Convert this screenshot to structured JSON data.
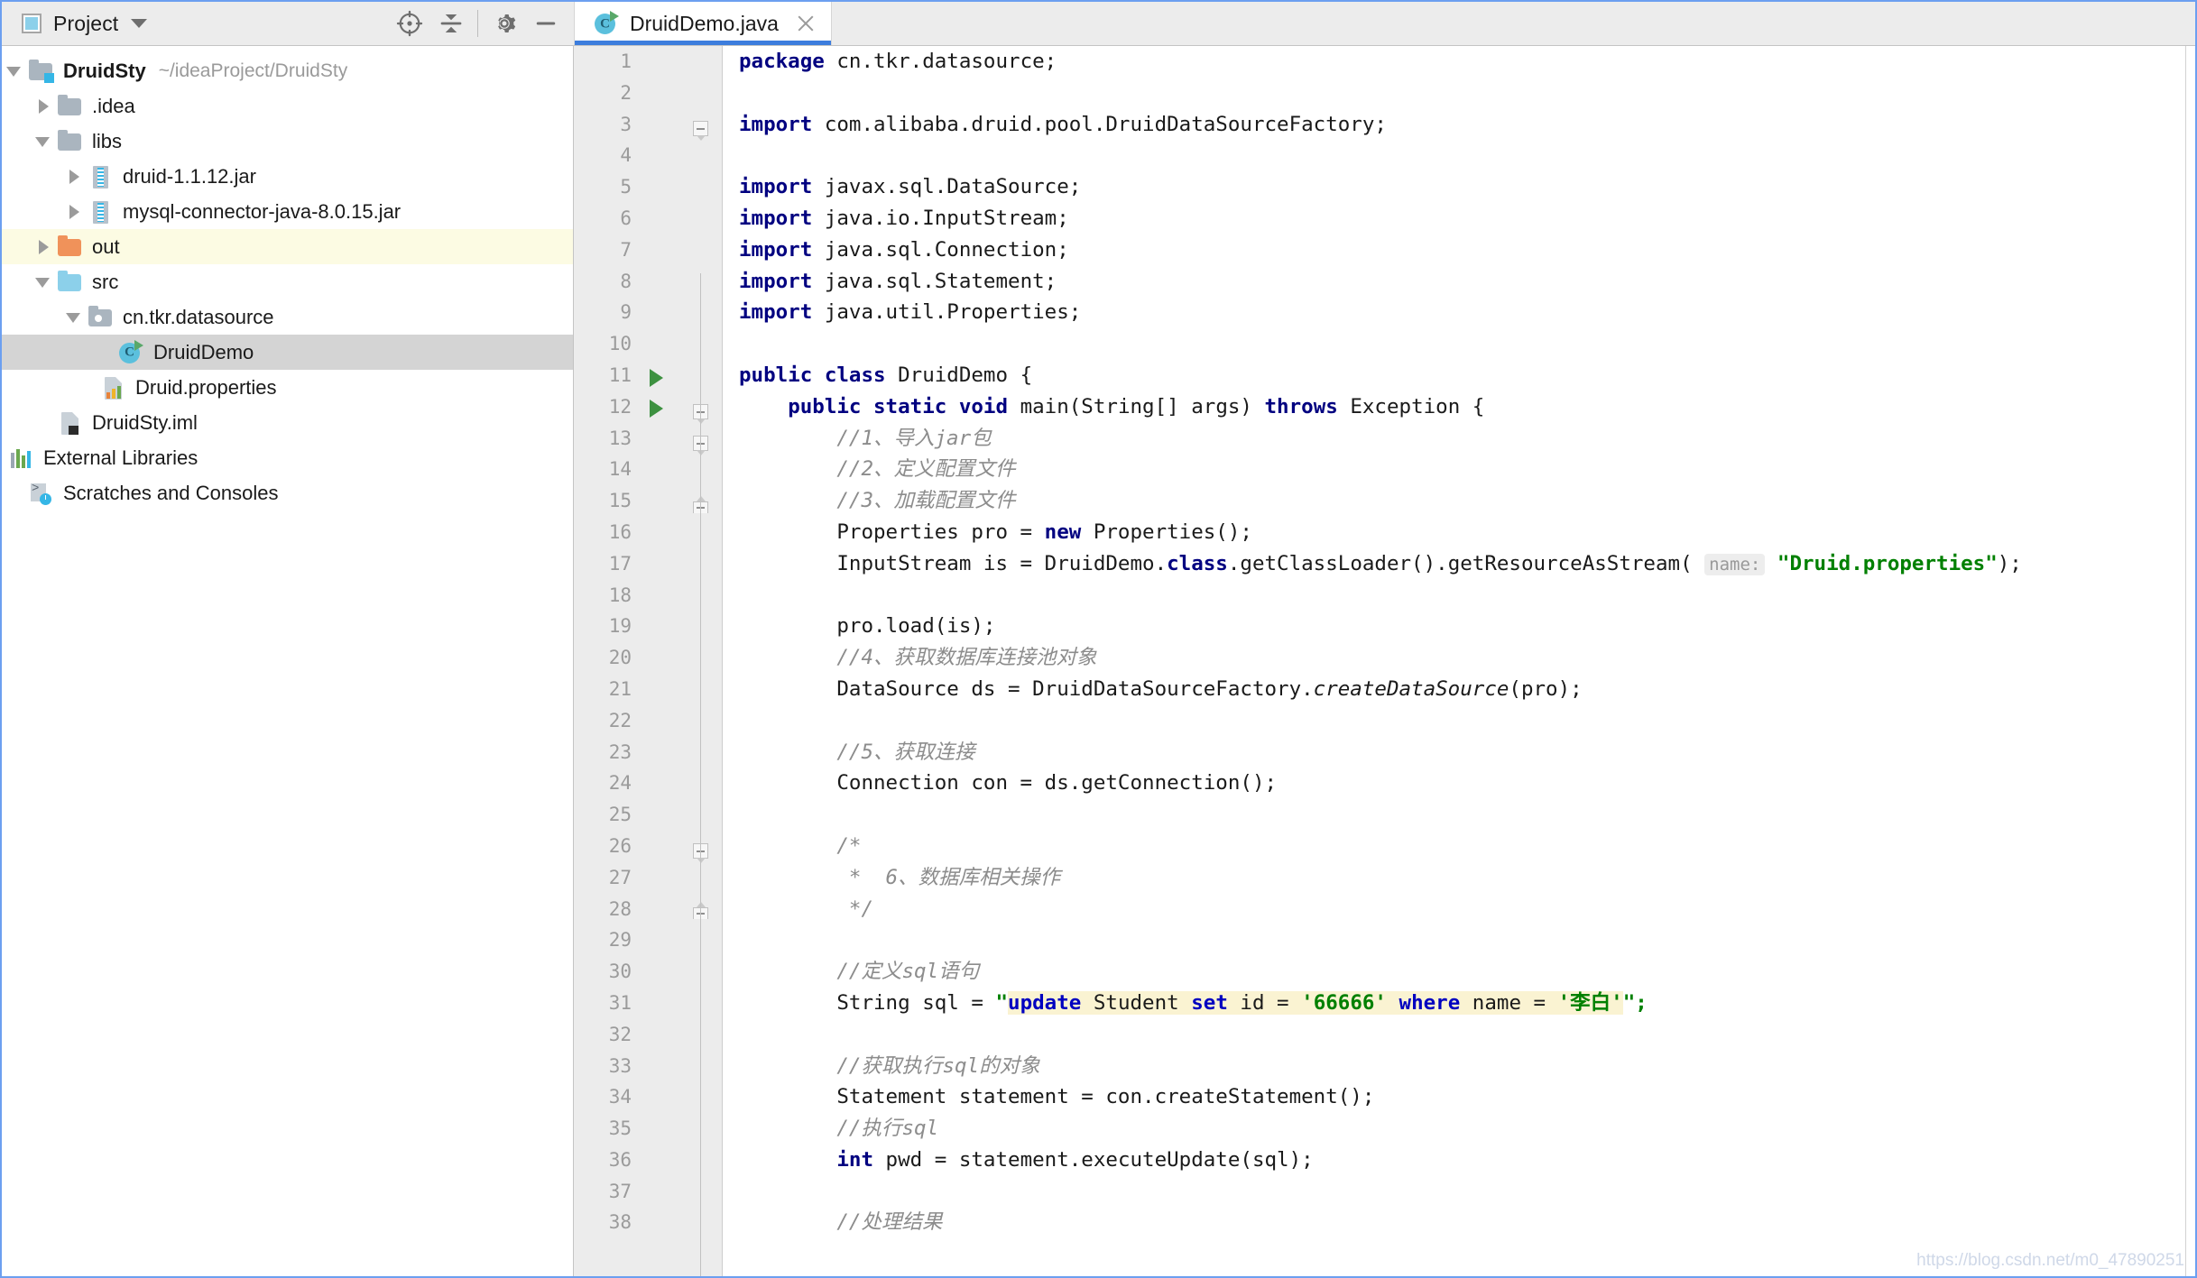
{
  "window": {
    "accent_color": "#3c7ddd",
    "border_color": "#6c9ff0"
  },
  "tool_window": {
    "title": "Project",
    "dropdown_icon": "chevron-down-icon",
    "actions": [
      {
        "name": "locate-in-tree",
        "icon": "crosshair-target-icon"
      },
      {
        "name": "collapse-all",
        "icon": "collapse-all-icon"
      },
      {
        "name": "settings",
        "icon": "gear-icon"
      },
      {
        "name": "hide-tool-window",
        "icon": "minimize-icon"
      }
    ]
  },
  "editor_tabs": [
    {
      "label": "DruidDemo.java",
      "icon": "java-class-runnable-icon",
      "active": true,
      "close_icon": "close-icon"
    }
  ],
  "project_tree": [
    {
      "label": "DruidSty",
      "path": "~/ideaProject/DruidSty",
      "indent": 0,
      "twisty": "open",
      "icon": "module-folder-icon",
      "bold": true,
      "state": "normal"
    },
    {
      "label": ".idea",
      "indent": 1,
      "twisty": "closed",
      "icon": "folder-icon",
      "bold": false,
      "state": "normal"
    },
    {
      "label": "libs",
      "indent": 1,
      "twisty": "open",
      "icon": "folder-icon",
      "bold": false,
      "state": "normal"
    },
    {
      "label": "druid-1.1.12.jar",
      "indent": 2,
      "twisty": "closed",
      "icon": "jar-icon",
      "bold": false,
      "state": "normal"
    },
    {
      "label": "mysql-connector-java-8.0.15.jar",
      "indent": 2,
      "twisty": "closed",
      "icon": "jar-icon",
      "bold": false,
      "state": "normal"
    },
    {
      "label": "out",
      "indent": 1,
      "twisty": "closed",
      "icon": "excluded-folder-icon",
      "bold": false,
      "state": "excluded"
    },
    {
      "label": "src",
      "indent": 1,
      "twisty": "open",
      "icon": "source-folder-icon",
      "bold": false,
      "state": "normal"
    },
    {
      "label": "cn.tkr.datasource",
      "indent": 2,
      "twisty": "open",
      "icon": "package-icon",
      "bold": false,
      "state": "normal"
    },
    {
      "label": "DruidDemo",
      "indent": 3,
      "twisty": "none",
      "icon": "java-class-runnable-icon",
      "bold": false,
      "state": "selected"
    },
    {
      "label": "Druid.properties",
      "indent": 3,
      "twisty": "none",
      "icon": "properties-file-icon",
      "bold": false,
      "state": "normal"
    },
    {
      "label": "DruidSty.iml",
      "indent": 1,
      "twisty": "none",
      "icon": "iml-file-icon",
      "bold": false,
      "state": "normal"
    },
    {
      "label": "External Libraries",
      "indent": 0,
      "twisty": "closed",
      "icon": "external-libraries-icon",
      "bold": false,
      "state": "normal"
    },
    {
      "label": "Scratches and Consoles",
      "indent": 0,
      "twisty": "none",
      "icon": "scratches-icon",
      "bold": false,
      "state": "normal"
    }
  ],
  "editor": {
    "file_name": "DruidDemo.java",
    "first_visible_line": 1,
    "last_visible_line": 38,
    "run_gutter_lines": [
      11,
      12
    ],
    "fold_marks": [
      {
        "line": 3,
        "type": "start"
      },
      {
        "line": 12,
        "type": "start"
      },
      {
        "line": 13,
        "type": "start"
      },
      {
        "line": 15,
        "type": "end"
      },
      {
        "line": 26,
        "type": "start"
      },
      {
        "line": 28,
        "type": "end"
      }
    ],
    "line_numbers": [
      1,
      2,
      3,
      4,
      5,
      6,
      7,
      8,
      9,
      10,
      11,
      12,
      13,
      14,
      15,
      16,
      17,
      18,
      19,
      20,
      21,
      22,
      23,
      24,
      25,
      26,
      27,
      28,
      29,
      30,
      31,
      32,
      33,
      34,
      35,
      36,
      37,
      38
    ],
    "code_lines": [
      "package cn.tkr.datasource;",
      "",
      "import com.alibaba.druid.pool.DruidDataSourceFactory;",
      "",
      "import javax.sql.DataSource;",
      "import java.io.InputStream;",
      "import java.sql.Connection;",
      "import java.sql.Statement;",
      "import java.util.Properties;",
      "",
      "public class DruidDemo {",
      "    public static void main(String[] args) throws Exception {",
      "        //1、导入jar包",
      "        //2、定义配置文件",
      "        //3、加载配置文件",
      "        Properties pro = new Properties();",
      "        InputStream is = DruidDemo.class.getClassLoader().getResourceAsStream( name: \"Druid.properties\");",
      "",
      "        pro.load(is);",
      "        //4、获取数据库连接池对象",
      "        DataSource ds = DruidDataSourceFactory.createDataSource(pro);",
      "",
      "        //5、获取连接",
      "        Connection con = ds.getConnection();",
      "",
      "        /*",
      "         *  6、数据库相关操作",
      "         */",
      "",
      "        //定义sql语句",
      "        String sql = \"update Student set id = '66666' where name = '李白'\";",
      "",
      "        //获取执行sql的对象",
      "        Statement statement = con.createStatement();",
      "        //执行sql",
      "        int pwd = statement.executeUpdate(sql);",
      "",
      "        //处理结果"
    ],
    "parameter_hint": "name:",
    "string_literal": "\"Druid.properties\"",
    "sql_string": {
      "open_quote": "\"",
      "tokens": [
        {
          "text": "update",
          "kind": "sql-keyword"
        },
        {
          "text": " Student ",
          "kind": "sql-identifier"
        },
        {
          "text": "set",
          "kind": "sql-keyword"
        },
        {
          "text": " id = ",
          "kind": "sql-identifier"
        },
        {
          "text": "'66666'",
          "kind": "sql-string"
        },
        {
          "text": " ",
          "kind": "sql-identifier"
        },
        {
          "text": "where",
          "kind": "sql-keyword"
        },
        {
          "text": " name = ",
          "kind": "sql-identifier"
        },
        {
          "text": "'李白'",
          "kind": "sql-string"
        }
      ],
      "close_quote": "\";"
    },
    "syntax_colors": {
      "keyword": "#000080",
      "comment": "#8c8c8c",
      "string": "#008000",
      "sql_keyword": "#0000c0",
      "sql_injection_background": "#faf3d2",
      "gutter_background": "#ececec",
      "run_arrow": "#3d9140"
    }
  },
  "watermark": "https://blog.csdn.net/m0_47890251"
}
